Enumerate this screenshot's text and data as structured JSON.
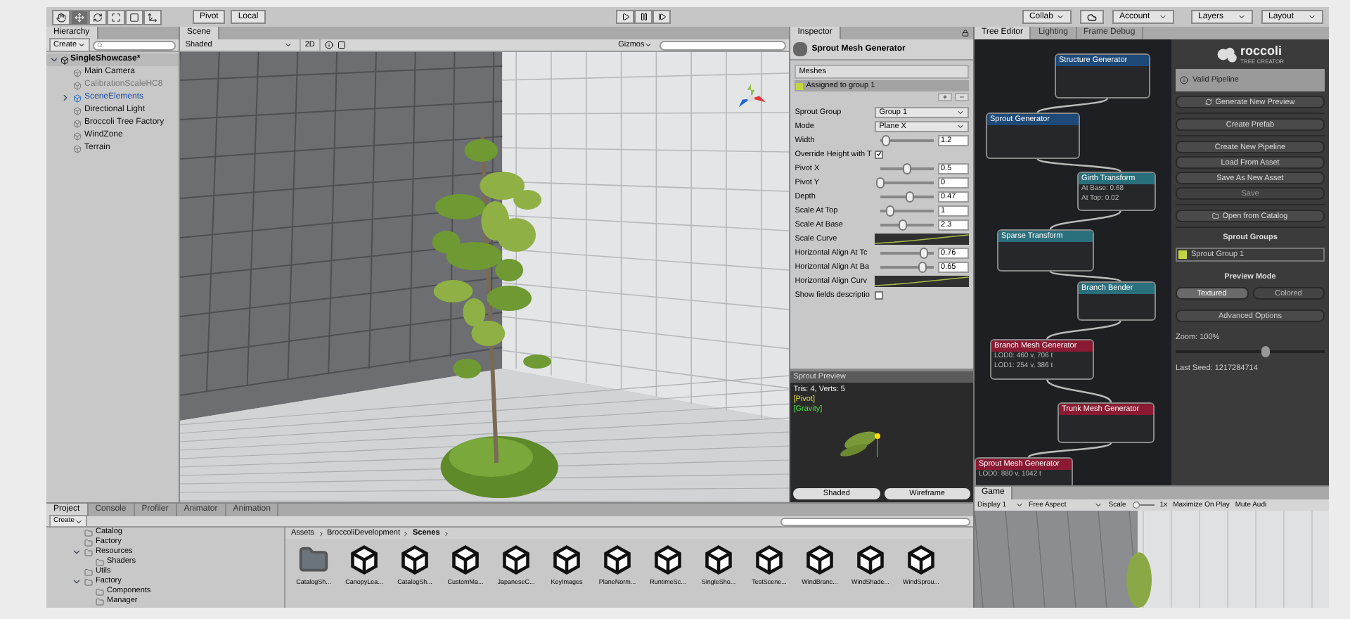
{
  "toolbar": {
    "tools": [
      {
        "kind": "hand",
        "selected": false
      },
      {
        "kind": "move",
        "selected": true
      },
      {
        "kind": "rotate",
        "selected": false
      },
      {
        "kind": "scale",
        "selected": false
      },
      {
        "kind": "rect",
        "selected": false
      },
      {
        "kind": "transform",
        "selected": false
      }
    ],
    "pivot": "Pivot",
    "local": "Local",
    "collab": "Collab",
    "account": "Account",
    "layers": "Layers",
    "layout": "Layout"
  },
  "hierarchy": {
    "tab": "Hierarchy",
    "create": "Create",
    "scene": {
      "label": "SingleShowcase*",
      "expanded": true,
      "children": [
        {
          "label": "Main Camera",
          "kind": "object"
        },
        {
          "label": "CalibrationScaleHC8",
          "kind": "inactive"
        },
        {
          "label": "SceneElements",
          "kind": "prefab",
          "expanded": false
        },
        {
          "label": "Directional Light",
          "kind": "object"
        },
        {
          "label": "Broccoli Tree Factory",
          "kind": "object"
        },
        {
          "label": "WindZone",
          "kind": "object"
        },
        {
          "label": "Terrain",
          "kind": "object"
        }
      ]
    }
  },
  "scene": {
    "tab": "Scene",
    "shading": "Shaded",
    "mode_2d": "2D",
    "gizmos": "Gizmos"
  },
  "inspector": {
    "tab": "Inspector",
    "component": "Sprout Mesh Generator",
    "meshes_header": "Meshes",
    "meshes": [
      {
        "label": "Assigned to group 1",
        "color": "#c3d640"
      }
    ],
    "fields": [
      {
        "kind": "dropdown",
        "label": "Sprout Group",
        "value": "Group 1"
      },
      {
        "kind": "dropdown",
        "label": "Mode",
        "value": "Plane X"
      },
      {
        "kind": "slider",
        "label": "Width",
        "value": "1.2",
        "level": 0.1
      },
      {
        "kind": "checkbox",
        "label": "Override Height with T",
        "checked": true
      },
      {
        "kind": "slider",
        "label": "Pivot X",
        "value": "0.5",
        "level": 0.5
      },
      {
        "kind": "slider",
        "label": "Pivot Y",
        "value": "0",
        "level": 0
      },
      {
        "kind": "slider",
        "label": "Depth",
        "value": "0.47",
        "level": 0.55
      },
      {
        "kind": "slider",
        "label": "Scale At Top",
        "value": "1",
        "level": 0.18
      },
      {
        "kind": "slider",
        "label": "Scale At Base",
        "value": "2.3",
        "level": 0.42
      },
      {
        "kind": "curve",
        "label": "Scale Curve"
      },
      {
        "kind": "slider",
        "label": "Horizontal Align At Tc",
        "value": "0.76",
        "level": 0.82
      },
      {
        "kind": "slider",
        "label": "Horizontal Align At Ba",
        "value": "0.65",
        "level": 0.78
      },
      {
        "kind": "curve",
        "label": "Horizontal Align Curv"
      },
      {
        "kind": "checkbox",
        "label": "Show fields descriptio",
        "checked": false
      }
    ],
    "preview": {
      "title": "Sprout Preview",
      "stats": "Tris: 4, Verts: 5",
      "pivot": "[Pivot]",
      "gravity": "[Gravity]",
      "buttons": [
        "Shaded",
        "Wireframe"
      ]
    }
  },
  "tree_editor": {
    "tabs": [
      {
        "label": "Tree Editor",
        "selected": true
      },
      {
        "label": "Lighting",
        "selected": false
      },
      {
        "label": "Frame Debug",
        "selected": false
      }
    ],
    "nodes": [
      {
        "title": "Structure Generator",
        "color": "#1d4a78"
      },
      {
        "title": "Sprout Generator",
        "color": "#1d4a78"
      },
      {
        "title": "Girth Transform",
        "color": "#2a6f7c",
        "lines": [
          "At Base: 0.68",
          "At Top: 0.02"
        ]
      },
      {
        "title": "Sparse Transform",
        "color": "#2a6f7c"
      },
      {
        "title": "Branch Bender",
        "color": "#2a6f7c"
      },
      {
        "title": "Branch Mesh Generator",
        "color": "#8a1a32",
        "lines": [
          "LOD0: 460 v, 706 t",
          "LOD1: 254 v, 386 t"
        ]
      },
      {
        "title": "Trunk Mesh Generator",
        "color": "#8a1a32"
      },
      {
        "title": "Sprout Mesh Generator",
        "color": "#8a1a32",
        "lines": [
          "LOD0: 880 v, 1042 t"
        ]
      }
    ],
    "logo": {
      "name": "roccoli",
      "tagline": "TREE CREATOR"
    },
    "status": "Valid Pipeline",
    "button_groups": [
      [
        {
          "label": "Generate New Preview",
          "kind": "refresh",
          "disabled": false
        }
      ],
      [
        {
          "label": "Create Prefab",
          "kind": "plain",
          "disabled": false
        }
      ],
      [
        {
          "label": "Create New Pipeline",
          "kind": "plain",
          "disabled": false
        },
        {
          "label": "Load From Asset",
          "kind": "plain",
          "disabled": false
        },
        {
          "label": "Save As New Asset",
          "kind": "plain",
          "disabled": false
        },
        {
          "label": "Save",
          "kind": "plain",
          "disabled": true
        }
      ],
      [
        {
          "label": "Open from Catalog",
          "kind": "folder",
          "disabled": false
        }
      ]
    ],
    "sprout_groups_title": "Sprout Groups",
    "sprout_groups": [
      {
        "label": "Sprout Group 1",
        "color": "#c3d640"
      }
    ],
    "preview_mode_title": "Preview Mode",
    "preview_modes": [
      {
        "label": "Textured",
        "selected": true
      },
      {
        "label": "Colored",
        "selected": false
      }
    ],
    "advanced": "Advanced Options",
    "zoom": {
      "label": "Zoom: 100%",
      "level": 0.6
    },
    "last_seed": "Last Seed: 1217284714"
  },
  "game": {
    "tab": "Game",
    "display": "Display 1",
    "aspect": "Free Aspect",
    "scale_label": "Scale",
    "scale_value": "1x",
    "maximize": "Maximize On Play",
    "mute": "Mute Audi"
  },
  "project": {
    "tabs": [
      {
        "label": "Project",
        "selected": true
      },
      {
        "label": "Console",
        "selected": false
      },
      {
        "label": "Profiler",
        "selected": false
      },
      {
        "label": "Animator",
        "selected": false
      },
      {
        "label": "Animation",
        "selected": false
      }
    ],
    "create": "Create",
    "folders": [
      {
        "label": "Catalog"
      },
      {
        "label": "Factory"
      },
      {
        "label": "Resources",
        "expanded": true,
        "children": [
          {
            "label": "Shaders"
          }
        ]
      },
      {
        "label": "Utils"
      },
      {
        "label": "Factory",
        "expanded": true,
        "children": [
          {
            "label": "Components"
          },
          {
            "label": "Manager"
          }
        ]
      }
    ],
    "breadcrumb": [
      "Assets",
      "BroccoliDevelopment",
      "Scenes"
    ],
    "assets": [
      {
        "label": "CatalogSh...",
        "kind": "folder"
      },
      {
        "label": "CanopyLea...",
        "kind": "scene"
      },
      {
        "label": "CatalogSh...",
        "kind": "scene"
      },
      {
        "label": "CustomMa...",
        "kind": "scene"
      },
      {
        "label": "JapaneseC...",
        "kind": "scene"
      },
      {
        "label": "KeyImages",
        "kind": "scene"
      },
      {
        "label": "PlaneNorm...",
        "kind": "scene"
      },
      {
        "label": "RuntimeSc...",
        "kind": "scene"
      },
      {
        "label": "SingleSho...",
        "kind": "scene"
      },
      {
        "label": "TestScene...",
        "kind": "scene"
      },
      {
        "label": "WindBranc...",
        "kind": "scene"
      },
      {
        "label": "WindShade...",
        "kind": "scene"
      },
      {
        "label": "WindSprou...",
        "kind": "scene"
      }
    ]
  }
}
